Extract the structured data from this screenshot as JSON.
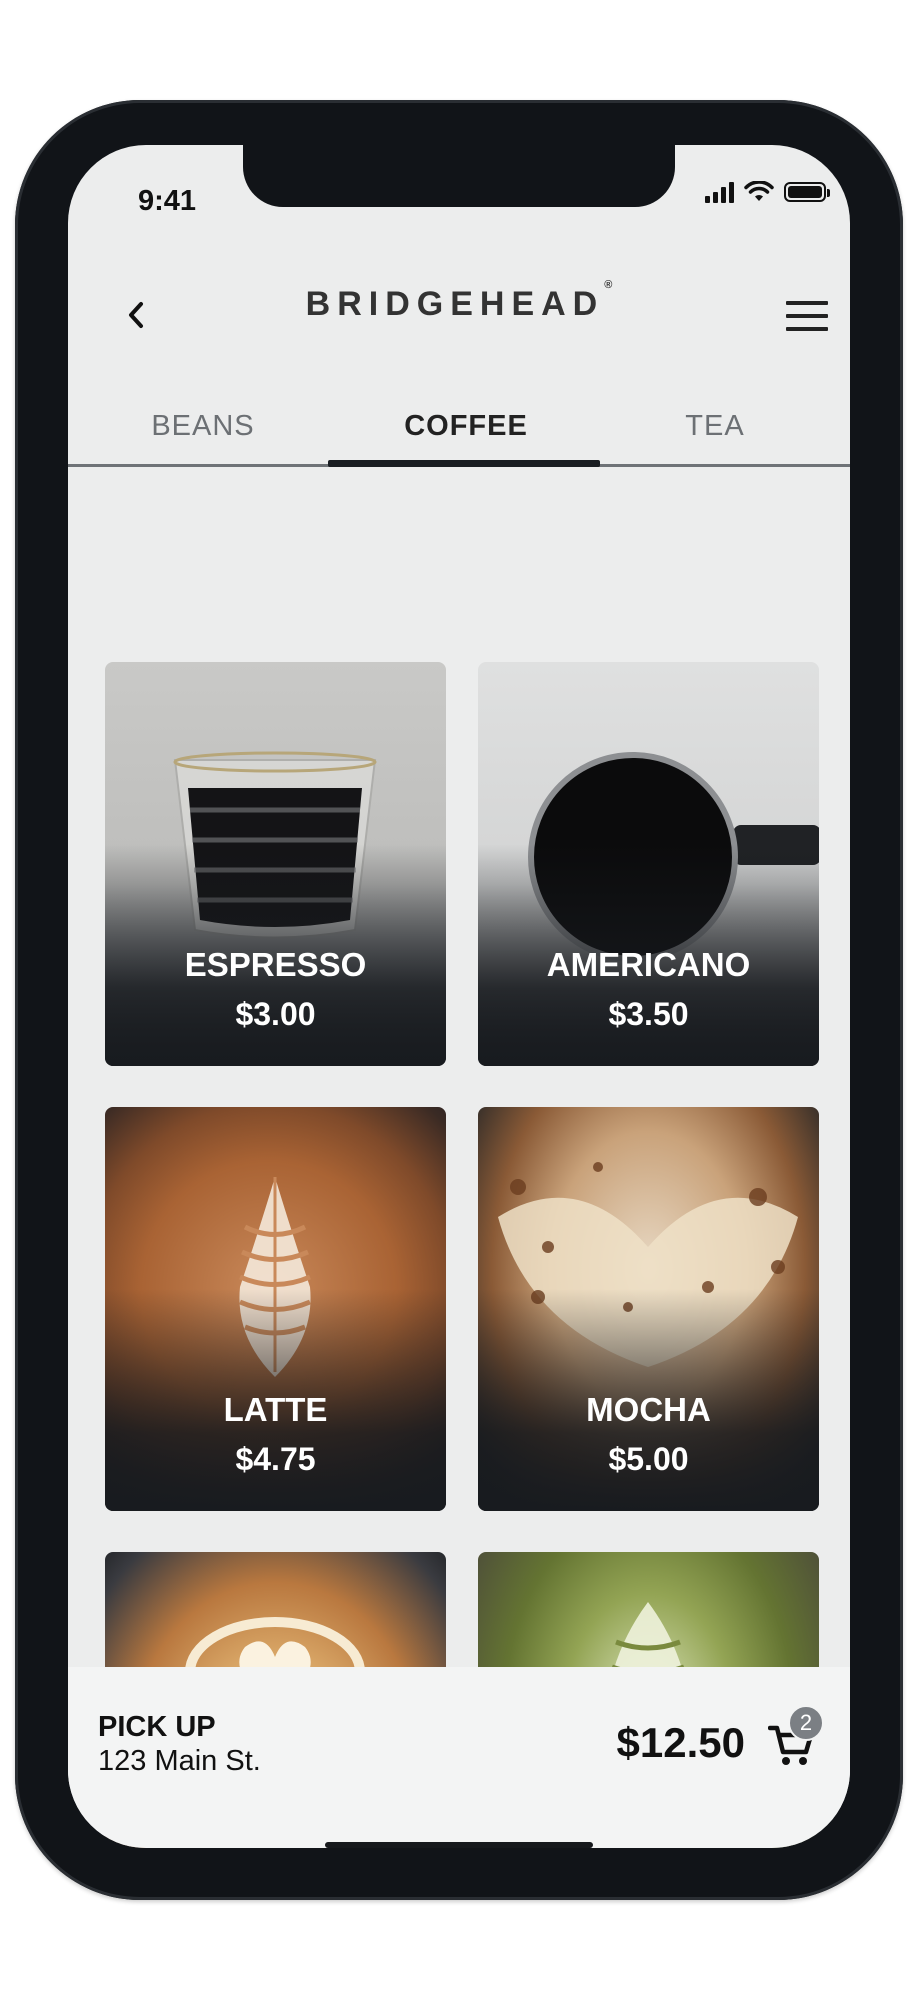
{
  "status": {
    "time": "9:41"
  },
  "header": {
    "brand": "BRIDGEHEAD",
    "brand_mark": "®"
  },
  "tabs": [
    {
      "label": "BEANS",
      "active": false
    },
    {
      "label": "COFFEE",
      "active": true
    },
    {
      "label": "TEA",
      "active": false
    }
  ],
  "products": [
    {
      "name": "ESPRESSO",
      "price": "$3.00"
    },
    {
      "name": "AMERICANO",
      "price": "$3.50"
    },
    {
      "name": "LATTE",
      "price": "$4.75"
    },
    {
      "name": "MOCHA",
      "price": "$5.00"
    },
    {
      "name": "",
      "price": ""
    },
    {
      "name": "",
      "price": ""
    }
  ],
  "footer": {
    "pickup_label": "PICK UP",
    "pickup_address": "123 Main St.",
    "total": "$12.50",
    "cart_count": "2"
  },
  "icons": {
    "back": "chevron-left-icon",
    "menu": "hamburger-menu-icon",
    "cart": "shopping-cart-icon",
    "signal": "cellular-signal-icon",
    "wifi": "wifi-icon",
    "battery": "battery-icon"
  },
  "colors": {
    "dark": "#111418",
    "screen_bg": "#eceded",
    "badge": "#7b7f84"
  }
}
